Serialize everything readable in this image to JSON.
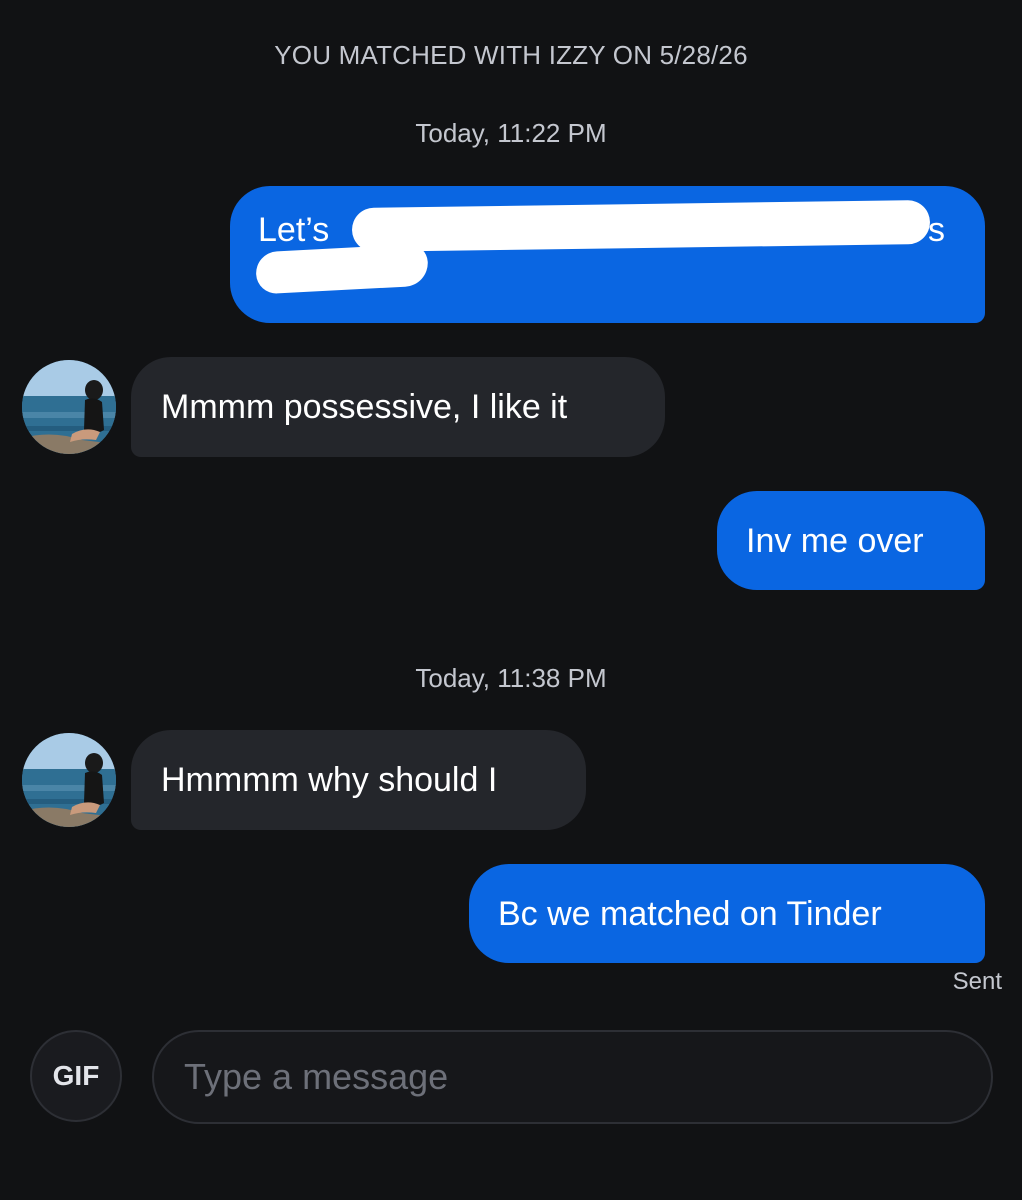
{
  "header": {
    "match_text": "YOU MATCHED WITH IZZY ON 5/28/26"
  },
  "timestamps": [
    "Today, 11:22 PM",
    "Today, 11:38 PM"
  ],
  "messages": [
    {
      "direction": "outgoing",
      "text": "Let’s",
      "redacted": true,
      "visible_trailing_char": "s"
    },
    {
      "direction": "incoming",
      "text": "Mmmm possessive, I like it"
    },
    {
      "direction": "outgoing",
      "text": "Inv me over"
    },
    {
      "direction": "incoming",
      "text": "Hmmmm why should I"
    },
    {
      "direction": "outgoing",
      "text": "Bc we matched on Tinder"
    }
  ],
  "status": {
    "sent_label": "Sent"
  },
  "composer": {
    "gif_label": "GIF",
    "placeholder": "Type a message"
  },
  "colors": {
    "background": "#111214",
    "outgoing_bubble": "#0a66e2",
    "incoming_bubble": "#24262b",
    "meta_text": "#c4c7cf"
  }
}
